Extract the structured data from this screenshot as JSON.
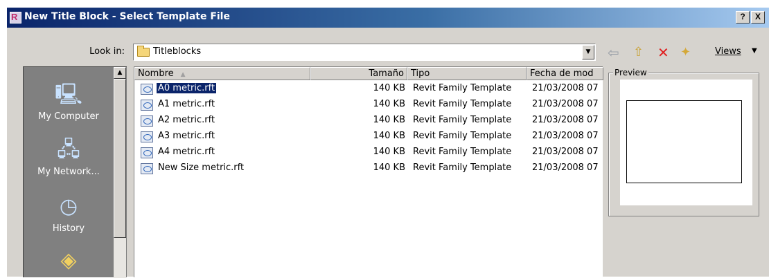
{
  "window": {
    "title": "New Title Block - Select Template File",
    "help_label": "?",
    "close_label": "X"
  },
  "look_in": {
    "label": "Look in:",
    "value": "Titleblocks"
  },
  "toolbar": {
    "views_label": "Views",
    "icons": [
      "back-arrow-icon",
      "up-folder-icon",
      "delete-icon",
      "new-folder-icon"
    ]
  },
  "places": [
    {
      "label": "My Computer",
      "icon": "my-computer-icon"
    },
    {
      "label": "My Network...",
      "icon": "my-network-icon"
    },
    {
      "label": "History",
      "icon": "history-icon"
    }
  ],
  "file_list": {
    "columns": [
      "Nombre",
      "Tamaño",
      "Tipo",
      "Fecha de mod"
    ],
    "rows": [
      {
        "name": "A0 metric.rft",
        "size": "140 KB",
        "type": "Revit Family Template",
        "date": "21/03/2008 07",
        "selected": true
      },
      {
        "name": "A1 metric.rft",
        "size": "140 KB",
        "type": "Revit Family Template",
        "date": "21/03/2008 07",
        "selected": false
      },
      {
        "name": "A2 metric.rft",
        "size": "140 KB",
        "type": "Revit Family Template",
        "date": "21/03/2008 07",
        "selected": false
      },
      {
        "name": "A3 metric.rft",
        "size": "140 KB",
        "type": "Revit Family Template",
        "date": "21/03/2008 07",
        "selected": false
      },
      {
        "name": "A4 metric.rft",
        "size": "140 KB",
        "type": "Revit Family Template",
        "date": "21/03/2008 07",
        "selected": false
      },
      {
        "name": "New Size metric.rft",
        "size": "140 KB",
        "type": "Revit Family Template",
        "date": "21/03/2008 07",
        "selected": false
      }
    ]
  },
  "preview": {
    "label": "Preview"
  },
  "colors": {
    "titlebar_start": "#0a246a",
    "titlebar_end": "#a6caf0",
    "selection": "#0a246a",
    "dialog_face": "#d6d3ce",
    "places_bar": "#808080",
    "delete_icon": "#e02020"
  }
}
